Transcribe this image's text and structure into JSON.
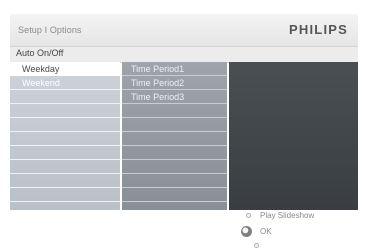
{
  "header": {
    "breadcrumb": "Setup I Options",
    "brand": "PHILIPS"
  },
  "subheader": {
    "title": "Auto On/Off"
  },
  "menu": {
    "days": [
      "Weekday",
      "Weekend"
    ],
    "selected_day": "Weekday",
    "periods": [
      "Time Period1",
      "Time Period2",
      "Time Period3"
    ]
  },
  "footer": {
    "hints": [
      "Play Slideshow",
      "OK"
    ]
  },
  "icons": {
    "ok_button": "ok-button-icon",
    "nav_dots": "nav-dot-icon"
  },
  "colors": {
    "selected_row": "#ffffff",
    "col1_bg": "#c4cbd0",
    "col2_bg": "#959ba0",
    "col3_bg": "#42464a"
  }
}
